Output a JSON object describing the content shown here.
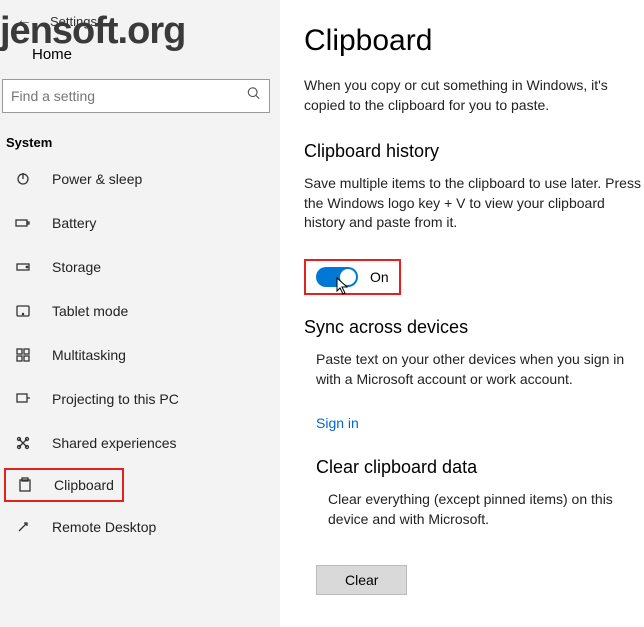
{
  "watermark": "jensoft.org",
  "header": {
    "title": "Settings",
    "home": "Home"
  },
  "search": {
    "placeholder": "Find a setting"
  },
  "category": "System",
  "nav": [
    {
      "label": "Power & sleep"
    },
    {
      "label": "Battery"
    },
    {
      "label": "Storage"
    },
    {
      "label": "Tablet mode"
    },
    {
      "label": "Multitasking"
    },
    {
      "label": "Projecting to this PC"
    },
    {
      "label": "Shared experiences"
    },
    {
      "label": "Clipboard"
    },
    {
      "label": "Remote Desktop"
    }
  ],
  "main": {
    "title": "Clipboard",
    "intro": "When you copy or cut something in Windows, it's copied to the clipboard for you to paste.",
    "history": {
      "heading": "Clipboard history",
      "desc": "Save multiple items to the clipboard to use later. Press the Windows logo key + V to view your clipboard history and paste from it.",
      "toggle_state": "On"
    },
    "sync": {
      "heading": "Sync across devices",
      "desc": "Paste text on your other devices when you sign in with a Microsoft account or work account.",
      "signin": "Sign in"
    },
    "clear": {
      "heading": "Clear clipboard data",
      "desc": "Clear everything (except pinned items) on this device and with Microsoft.",
      "button": "Clear"
    }
  }
}
